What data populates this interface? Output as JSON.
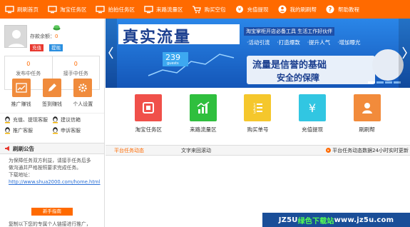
{
  "nav": {
    "items": [
      {
        "label": "刷刷首页",
        "icon": "monitor-icon"
      },
      {
        "label": "淘宝任务区",
        "icon": "monitor-icon"
      },
      {
        "label": "拍拍任务区",
        "icon": "monitor-icon"
      },
      {
        "label": "来路流量区",
        "icon": "monitor-icon"
      },
      {
        "label": "购买空包",
        "icon": "cart-icon"
      },
      {
        "label": "充值提现",
        "icon": "coin-icon"
      },
      {
        "label": "我的刷刷帮",
        "icon": "user-icon"
      },
      {
        "label": "帮助教程",
        "icon": "help-icon"
      }
    ]
  },
  "user": {
    "balance_label": "存款余额：",
    "balance_value": "0",
    "recharge_btn": "充值",
    "withdraw_btn": "提现"
  },
  "stats": [
    {
      "num": "0",
      "label": "发布中任务"
    },
    {
      "num": "0",
      "label": "接手中任务"
    }
  ],
  "quick": [
    {
      "label": "推广赚钱",
      "icon": "chart-icon"
    },
    {
      "label": "签到赚钱",
      "icon": "pen-icon"
    },
    {
      "label": "个人设置",
      "icon": "gear-icon"
    }
  ],
  "services": [
    {
      "label": "充值、提现客服"
    },
    {
      "label": "建议信箱"
    },
    {
      "label": "推广客服"
    },
    {
      "label": "申诉客服"
    }
  ],
  "notice": {
    "title": "刷刷公告",
    "line1": "为保障任务双方利益，请接手任务后多",
    "line2": "做沟通并严格按照要求完成任务。",
    "line3": "下载地址：",
    "link": "http://www.shua2000.com/home.html"
  },
  "help_btn": "新手指南",
  "copy_tip": "复制以下您的专属个人链接进行推广，",
  "banner": {
    "title": "真实流量",
    "subtitle": "淘宝掌柜开店必备工具  生活工作好伙伴",
    "tags": [
      "·活动引流",
      "·打造爆款",
      "·提升人气",
      "·增加曝光"
    ],
    "slogan1": "流量是信誉的基础",
    "slogan2": "安全的保障",
    "counter": "239",
    "counter_label": "guests"
  },
  "features": [
    {
      "label": "淘宝任务区",
      "color": "#f0504a",
      "icon": "task-icon"
    },
    {
      "label": "来路流量区",
      "color": "#2fbf3e",
      "icon": "bar-chart-icon"
    },
    {
      "label": "购买单号",
      "color": "#f5c72c",
      "icon": "list-icon"
    },
    {
      "label": "充值提现",
      "color": "#31c6e2",
      "icon": "yen-icon"
    },
    {
      "label": "刷刷帮",
      "color": "#f28b3b",
      "icon": "person-icon"
    }
  ],
  "tabs": {
    "tab1": "平台任务动态",
    "tab2": "文字来回滚动",
    "tab3": "平台任务动态数据24小时实时更新"
  },
  "watermark": {
    "part1": "JZ5U",
    "part2": "绿色下载站",
    "part3": "www.jz5u.com"
  }
}
